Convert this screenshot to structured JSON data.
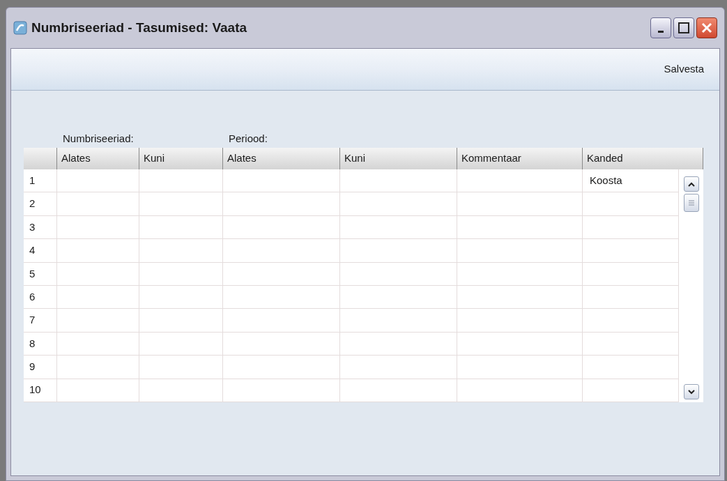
{
  "window": {
    "title": "Numbriseeriad - Tasumised: Vaata"
  },
  "toolbar": {
    "buttons": [
      "Salvesta"
    ]
  },
  "column_groups": [
    "Numbriseeriad:",
    "Periood:"
  ],
  "table": {
    "columns": [
      "Alates",
      "Kuni",
      "Alates",
      "Kuni",
      "Kommentaar",
      "Kanded"
    ],
    "rows": [
      {
        "number": "1",
        "kanded": "Koosta"
      },
      {
        "number": "2"
      },
      {
        "number": "3"
      },
      {
        "number": "4"
      },
      {
        "number": "5"
      },
      {
        "number": "6"
      },
      {
        "number": "7"
      },
      {
        "number": "8"
      },
      {
        "number": "9"
      },
      {
        "number": "10"
      }
    ]
  }
}
